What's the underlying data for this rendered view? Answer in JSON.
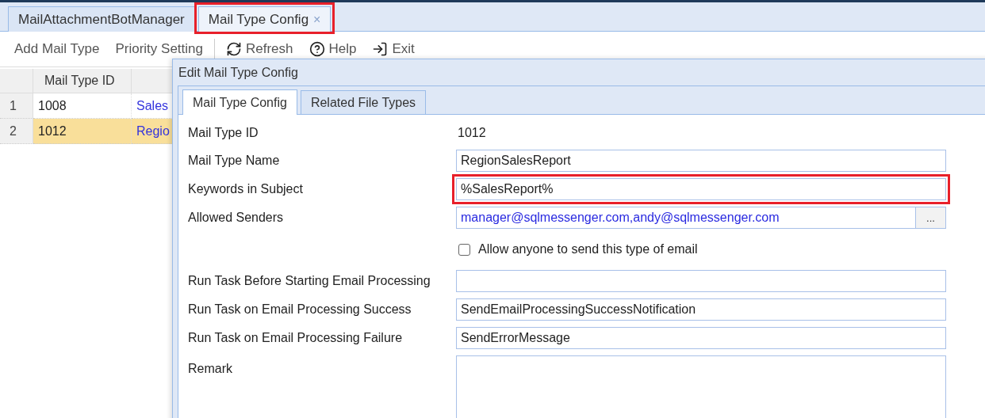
{
  "tabs": [
    {
      "label": "MailAttachmentBotManager",
      "selected": false,
      "highlighted": false
    },
    {
      "label": "Mail Type Config",
      "close": "×",
      "selected": true,
      "highlighted": true
    }
  ],
  "toolbar": [
    {
      "label": "Add Mail Type"
    },
    {
      "label": "Priority Setting"
    },
    {
      "label": "Refresh"
    },
    {
      "label": "Help"
    },
    {
      "label": "Exit"
    }
  ],
  "table": {
    "columns": [
      "Mail Type ID"
    ],
    "rows": [
      {
        "number": "1",
        "id": "1008",
        "name": "Sales",
        "selected": false
      },
      {
        "number": "2",
        "id": "1012",
        "name": "Regio",
        "selected": true
      }
    ]
  },
  "dialog": {
    "title": "Edit Mail Type Config",
    "tabs": [
      {
        "label": "Mail Type Config",
        "selected": true
      },
      {
        "label": "Related File Types",
        "selected": false
      }
    ],
    "fields": [
      {
        "kind": "text",
        "label": "Mail Type ID",
        "value": "1012"
      },
      {
        "kind": "input",
        "label": "Mail Type Name",
        "value": "RegionSalesReport",
        "highlighted": false
      },
      {
        "kind": "input",
        "label": "Keywords in Subject",
        "value": "%SalesReport%",
        "highlighted": true
      },
      {
        "kind": "picker",
        "label": "Allowed Senders",
        "value": "manager@sqlmessenger.com,andy@sqlmessenger.com",
        "button": "...",
        "highlighted": false
      },
      {
        "kind": "checkbox",
        "text": "Allow anyone to send this type of email",
        "checked": false
      },
      {
        "kind": "input",
        "label": "Run Task Before Starting Email Processing",
        "highlighted": false
      },
      {
        "kind": "input",
        "label": "Run Task on Email Processing Success",
        "value": "SendEmailProcessingSuccessNotification",
        "highlighted": false
      },
      {
        "kind": "input",
        "label": "Run Task on Email Processing Failure",
        "value": "SendErrorMessage",
        "highlighted": false
      },
      {
        "kind": "textarea",
        "label": "Remark",
        "highlighted": false
      }
    ]
  }
}
